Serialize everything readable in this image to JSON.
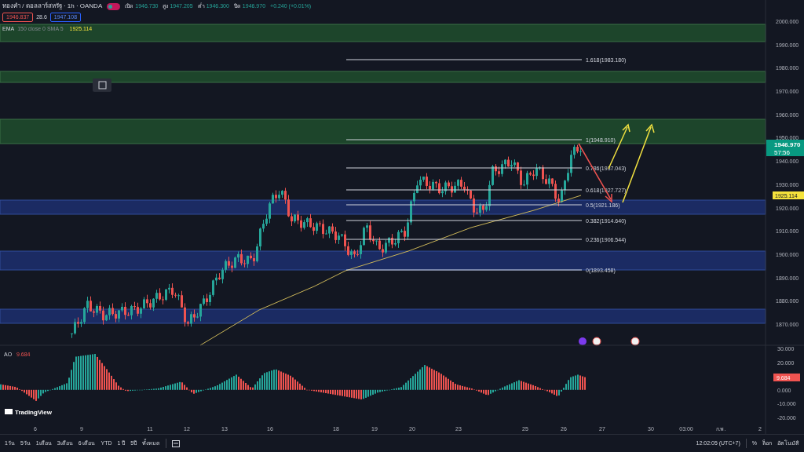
{
  "header": {
    "symbol": "ทองคำ / ดอลลาร์สหรัฐ · 1h · OANDA",
    "ohlc": [
      {
        "label": "เปิด",
        "value": "1946.730"
      },
      {
        "label": "สูง",
        "value": "1947.205"
      },
      {
        "label": "ต่ำ",
        "value": "1946.300"
      },
      {
        "label": "ปิด",
        "value": "1946.970"
      }
    ],
    "change": "+0.240 (+0.01%)",
    "sell": "1946.837",
    "spread": "28.6",
    "buy": "1947.108"
  },
  "indicator": {
    "name": "EMA",
    "params": "150 close 0 SMA 5",
    "value": "1925.114"
  },
  "fib_levels": [
    "1.618(1983.180)",
    "1(1948.910)",
    "0.786(1937.043)",
    "0.618(1927.727)",
    "0.5(1921.186)",
    "0.382(1914.640)",
    "0.236(1906.544)",
    "0(1893.458)"
  ],
  "price_axis": {
    "ticks": [
      "2000.000",
      "1990.000",
      "1980.000",
      "1970.000",
      "1960.000",
      "1950.000",
      "1940.000",
      "1930.000",
      "1920.000",
      "1910.000",
      "1900.000",
      "1890.000",
      "1880.000",
      "1870.000"
    ],
    "last_price": "1946.970",
    "countdown": "57:56",
    "ema_price": "1925.114"
  },
  "ao": {
    "name": "AO",
    "legend_value": "9.684",
    "value": "9.684",
    "ticks": [
      "30.000",
      "20.000",
      "0.000",
      "-10.000",
      "-20.000"
    ]
  },
  "logo": "TradingView",
  "time_axis": [
    "6",
    "9",
    "11",
    "12",
    "13",
    "16",
    "18",
    "19",
    "20",
    "23",
    "25",
    "26",
    "27",
    "30",
    "03:00",
    "ก.พ.",
    "2"
  ],
  "toolbar": {
    "ranges": [
      "1วัน",
      "5วัน",
      "1เดือน",
      "3เดือน",
      "6 เดือน",
      "YTD",
      "1 ปี",
      "5ปี",
      "ทั้งหมด"
    ],
    "time": "12:02:05 (UTC+7)",
    "options": [
      "%",
      "ล็อก",
      "อัตโนมัติ"
    ]
  }
}
